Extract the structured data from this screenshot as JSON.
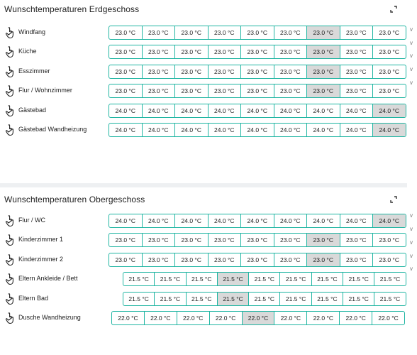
{
  "cards": [
    {
      "title": "Wunschtemperaturen Erdgeschoss",
      "rows": [
        {
          "label": "Windfang",
          "values": [
            "23.0 °C",
            "23.0 °C",
            "23.0 °C",
            "23.0 °C",
            "23.0 °C",
            "23.0 °C",
            "23.0 °C",
            "23.0 °C",
            "23.0 °C"
          ],
          "active": 6
        },
        {
          "label": "Küche",
          "values": [
            "23.0 °C",
            "23.0 °C",
            "23.0 °C",
            "23.0 °C",
            "23.0 °C",
            "23.0 °C",
            "23.0 °C",
            "23.0 °C",
            "23.0 °C"
          ],
          "active": 6
        },
        {
          "label": "Esszimmer",
          "values": [
            "23.0 °C",
            "23.0 °C",
            "23.0 °C",
            "23.0 °C",
            "23.0 °C",
            "23.0 °C",
            "23.0 °C",
            "23.0 °C",
            "23.0 °C"
          ],
          "active": 6
        },
        {
          "label": "Flur / Wohnzimmer",
          "values": [
            "23.0 °C",
            "23.0 °C",
            "23.0 °C",
            "23.0 °C",
            "23.0 °C",
            "23.0 °C",
            "23.0 °C",
            "23.0 °C",
            "23.0 °C"
          ],
          "active": 6
        },
        {
          "label": "Gästebad",
          "values": [
            "24.0 °C",
            "24.0 °C",
            "24.0 °C",
            "24.0 °C",
            "24.0 °C",
            "24.0 °C",
            "24.0 °C",
            "24.0 °C",
            "24.0 °C"
          ],
          "active": 8
        },
        {
          "label": "Gästebad Wandheizung",
          "values": [
            "24.0 °C",
            "24.0 °C",
            "24.0 °C",
            "24.0 °C",
            "24.0 °C",
            "24.0 °C",
            "24.0 °C",
            "24.0 °C",
            "24.0 °C"
          ],
          "active": 8
        }
      ]
    },
    {
      "title": "Wunschtemperaturen Obergeschoss",
      "rows": [
        {
          "label": "Flur / WC",
          "values": [
            "24.0 °C",
            "24.0 °C",
            "24.0 °C",
            "24.0 °C",
            "24.0 °C",
            "24.0 °C",
            "24.0 °C",
            "24.0 °C",
            "24.0 °C"
          ],
          "active": 8
        },
        {
          "label": "Kinderzimmer 1",
          "values": [
            "23.0 °C",
            "23.0 °C",
            "23.0 °C",
            "23.0 °C",
            "23.0 °C",
            "23.0 °C",
            "23.0 °C",
            "23.0 °C",
            "23.0 °C"
          ],
          "active": 6
        },
        {
          "label": "Kinderzimmer 2",
          "values": [
            "23.0 °C",
            "23.0 °C",
            "23.0 °C",
            "23.0 °C",
            "23.0 °C",
            "23.0 °C",
            "23.0 °C",
            "23.0 °C",
            "23.0 °C"
          ],
          "active": 6
        },
        {
          "label": "Eltern Ankleide / Bett",
          "values": [
            "21.5 °C",
            "21.5 °C",
            "21.5 °C",
            "21.5 °C",
            "21.5 °C",
            "21.5 °C",
            "21.5 °C",
            "21.5 °C",
            "21.5 °C"
          ],
          "active": 3
        },
        {
          "label": "Eltern Bad",
          "values": [
            "21.5 °C",
            "21.5 °C",
            "21.5 °C",
            "21.5 °C",
            "21.5 °C",
            "21.5 °C",
            "21.5 °C",
            "21.5 °C",
            "21.5 °C"
          ],
          "active": 3
        },
        {
          "label": "Dusche Wandheizung",
          "values": [
            "22.0 °C",
            "22.0 °C",
            "22.0 °C",
            "22.0 °C",
            "22.0 °C",
            "22.0 °C",
            "22.0 °C",
            "22.0 °C",
            "22.0 °C"
          ],
          "active": 4
        }
      ]
    }
  ],
  "icons": {
    "row_icon": "hand-pointer-icon",
    "expand_icon": "expand-icon"
  },
  "colors": {
    "accent": "#1fb5a2",
    "active_bg": "#d9d9d9"
  },
  "sidebar_marks": [
    "v",
    "v",
    "v",
    "v",
    "v",
    "v",
    "v",
    "v",
    "v",
    "v"
  ]
}
